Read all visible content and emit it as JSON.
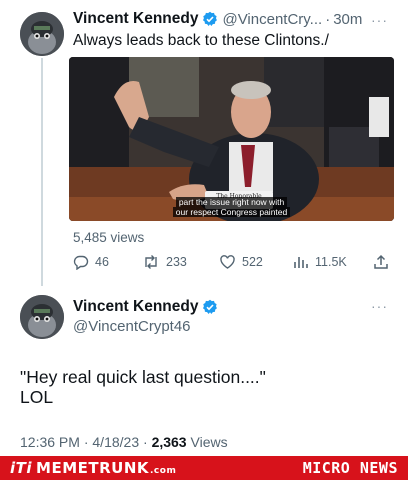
{
  "tweet1": {
    "name": "Vincent Kennedy",
    "handle": "@VincentCry...",
    "separator": "·",
    "time": "30m",
    "text": "Always leads back to these Clintons./",
    "video_caption_line1": "part the issue right now with",
    "video_caption_line2": "our respect Congress painted",
    "placard_text": "The Honorable",
    "views": "5,485 views",
    "replies": "46",
    "retweets": "233",
    "likes": "522",
    "analytics": "11.5K"
  },
  "tweet2": {
    "name": "Vincent Kennedy",
    "handle": "@VincentCrypt46",
    "text": "\"Hey real quick last question....\"\nLOL",
    "time": "12:36 PM",
    "date": "4/18/23",
    "separator": "·",
    "views_count": "2,363",
    "views_label": "Views"
  },
  "more_glyph": "···",
  "footer": {
    "left_icon_text": "iTi",
    "left_brand": "MEMETRUNK",
    "left_suffix": ".com",
    "right_brand": "MICRO NEWS"
  },
  "colors": {
    "verified": "#1d9bf0",
    "muted_text": "#536471",
    "footer_bg": "#d7121b"
  }
}
